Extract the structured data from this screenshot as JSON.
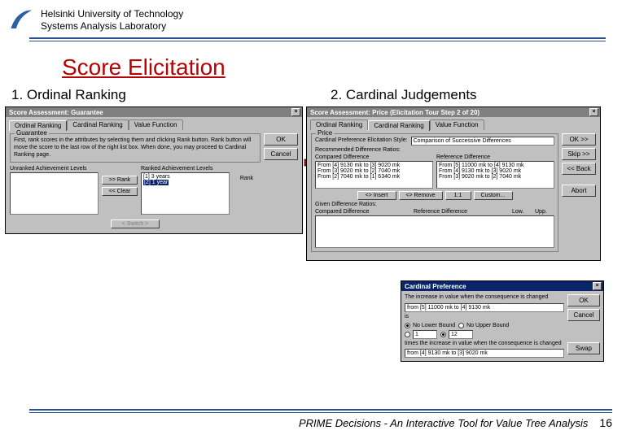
{
  "header": {
    "line1": "Helsinki University of Technology",
    "line2": "Systems Analysis Laboratory"
  },
  "page_title": "Score Elicitation",
  "subtitle_left": "1. Ordinal Ranking",
  "subtitle_right": "2. Cardinal Judgements",
  "dialog1": {
    "title": "Score Assessment: Guarantee",
    "tabs": [
      "Ordinal Ranking",
      "Cardinal Ranking",
      "Value Function"
    ],
    "desc": "First, rank scores in the attributes by selecting them and clicking Rank button. Rank button will move the score to the last row of the right list box. When done, you may proceed to Cardinal Ranking page.",
    "unranked_label": "Unranked Achievement Levels",
    "ranked_label": "Ranked Achievement Levels",
    "ranked_items": [
      "[1] 3 years",
      "[2] 1 year"
    ],
    "group2_title": "Guarantee",
    "btn_rank": "Rank",
    "btn_rank_top": ">> Rank",
    "btn_clear": "<< Clear",
    "btn_switch": "< Switch >",
    "side_ok": "OK",
    "side_cancel": "Cancel"
  },
  "dialog2": {
    "title": "Score Assessment: Price (Elicitation Tour Step 2 of 20)",
    "tabs": [
      "Ordinal Ranking",
      "Cardinal Ranking",
      "Value Function"
    ],
    "attr_name": "Price",
    "style_label": "Cardinal Preference Elicitation Style:",
    "style_value": "Comparison of Successive Differences",
    "rec_label": "Recommended Difference Ratios:",
    "col1": "Compared Difference",
    "col2": "Reference Difference",
    "rows_left": [
      "From [4] 9130 mk to [3] 9020 mk",
      "From [3] 9020 mk to [2] 7040 mk",
      "From [2] 7040 mk to [1] 6340 mk"
    ],
    "rows_right": [
      "From [5] 11000 mk to [4] 9130 mk",
      "From [4] 9130 mk to [3] 9020 mk",
      "From [3] 9020 mk to [2] 7040 mk"
    ],
    "btn_insert": "<> Insert",
    "btn_remove": "<> Remove",
    "btn_cp": "1:1",
    "btn_custom": "Custom...",
    "given_label": "Given Difference Ratios:",
    "given_cols": [
      "Compared Difference",
      "Reference Difference",
      "Low.",
      "Upp."
    ],
    "side_ok": "OK >>",
    "side_skip": "Skip >>",
    "side_back": "<< Back",
    "side_abort": "Abort"
  },
  "dialog3": {
    "title": "Cardinal Preference",
    "q1": "The increase in value when the consequence is changed",
    "f1": "from [5] 11000 mk to [4] 9130 mk",
    "q2": "is",
    "r1": "No Lower Bound",
    "r2": "No Upper Bound",
    "v1": "1",
    "v2": "12",
    "q3": "times the increase in value when the consequence is changed",
    "f2": "from [4] 9130 mk to [3] 9020 mk",
    "btn_ok": "OK",
    "btn_cancel": "Cancel",
    "btn_swap": "Swap"
  },
  "footer_text": "PRIME Decisions - An Interactive Tool for Value Tree Analysis",
  "page_number": "16"
}
